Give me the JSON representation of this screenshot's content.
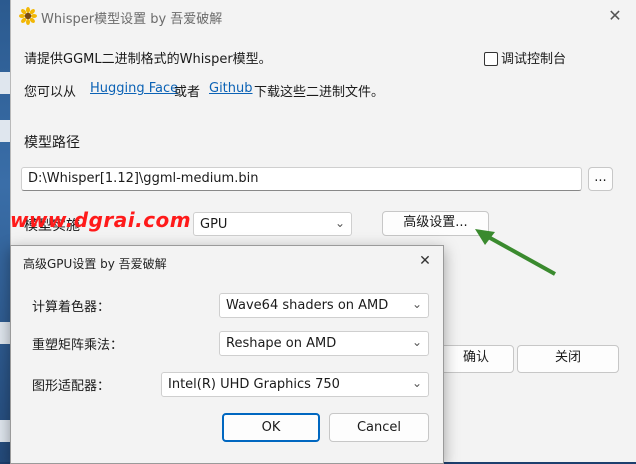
{
  "main_window": {
    "title": "Whisper模型设置 by 吾爱破解",
    "close_glyph": "✕",
    "intro_line": "请提供GGML二进制格式的Whisper模型。",
    "console_checkbox_label": "调试控制台",
    "download_prefix": "您可以从",
    "hugging_face_link": "Hugging Face",
    "download_or": "或者",
    "github_link": "Github",
    "download_suffix": "下载这些二进制文件。",
    "model_path_label": "模型路径",
    "model_path_value": "D:\\Whisper[1.12]\\ggml-medium.bin",
    "browse_label": "...",
    "model_impl_label": "模型实施",
    "model_impl_value": "GPU",
    "advanced_button": "高级设置...",
    "ok_button_partial": "确认",
    "close_button": "关闭"
  },
  "watermark": "www.dgrai.com",
  "advanced_dialog": {
    "title": "高级GPU设置 by 吾爱破解",
    "close_glyph": "✕",
    "shader_label": "计算着色器：",
    "shader_value": "Wave64 shaders on AMD",
    "reshape_label": "重塑矩阵乘法：",
    "reshape_value": "Reshape on AMD",
    "adapter_label": "图形适配器：",
    "adapter_value": "Intel(R) UHD Graphics 750",
    "ok_button": "OK",
    "cancel_button": "Cancel"
  },
  "colors": {
    "link": "#0b62b5",
    "primary_border": "#0067c0",
    "arrow": "#3a8a2e",
    "watermark": "#ff1a1a"
  }
}
